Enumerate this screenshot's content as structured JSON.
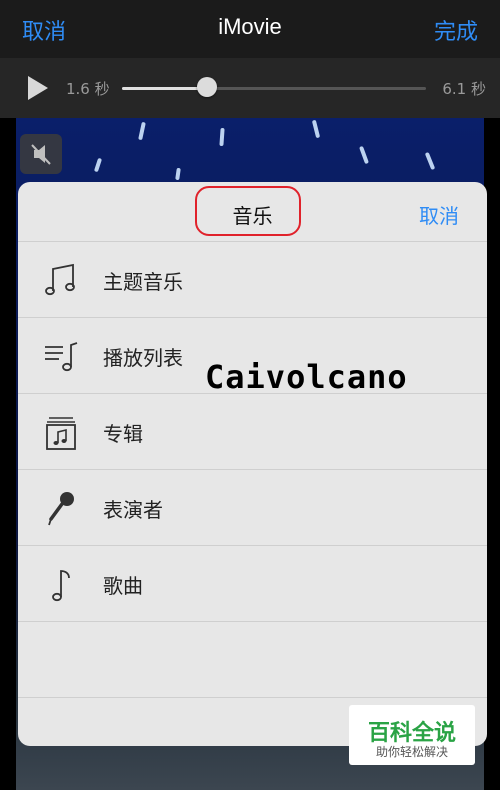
{
  "navbar": {
    "cancel_label": "取消",
    "title": "iMovie",
    "done_label": "完成"
  },
  "playback": {
    "current_time": "1.6 秒",
    "total_time": "6.1 秒",
    "progress": 0.28
  },
  "sheet": {
    "title": "音乐",
    "cancel_label": "取消",
    "items": [
      {
        "label": "主题音乐",
        "icon": "music-notes-icon"
      },
      {
        "label": "播放列表",
        "icon": "playlist-icon"
      },
      {
        "label": "专辑",
        "icon": "album-icon"
      },
      {
        "label": "表演者",
        "icon": "microphone-icon"
      },
      {
        "label": "歌曲",
        "icon": "music-note-icon"
      }
    ]
  },
  "overlay_text": "Caivolcano",
  "watermark": {
    "main": "百科全说",
    "sub": "助你轻松解决"
  },
  "colors": {
    "accent": "#2f8cf5",
    "highlight_ring": "#e0222b",
    "watermark_green": "#2aa345"
  }
}
